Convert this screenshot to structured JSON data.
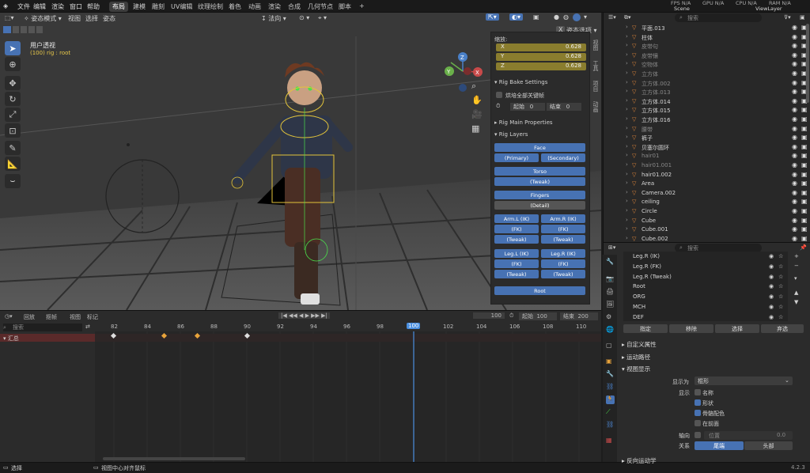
{
  "topbar": {
    "menus": [
      "文件",
      "编辑",
      "渲染",
      "窗口",
      "帮助"
    ],
    "workspaces": [
      "布局",
      "建模",
      "雕刻",
      "UV编辑",
      "纹理绘制",
      "着色",
      "动画",
      "渲染",
      "合成",
      "几何节点",
      "脚本"
    ],
    "active_workspace": "布局",
    "add_tab": "+",
    "scene": "Scene",
    "view_layer": "ViewLayer",
    "fps": "FPS N/A",
    "gpu": "GPU N/A",
    "cpu": "CPU N/A",
    "ram": "RAM N/A"
  },
  "viewport_header": {
    "mode": "姿态模式",
    "menus": [
      "视图",
      "选择",
      "姿态"
    ],
    "orientation": "法向",
    "pose_options": "姿态选项",
    "x_button": "X"
  },
  "viewport": {
    "perspective_label": "用户透视",
    "object_label": "(100) rig : root"
  },
  "npanel": {
    "scale_title": "缩放:",
    "x_label": "X",
    "x_value": "0.628",
    "y_label": "Y",
    "y_value": "0.628",
    "z_label": "Z",
    "z_value": "0.628",
    "bake_title": "Rig Bake Settings",
    "bake_all": "烘培全部关键帧",
    "start_label": "起始",
    "start_value": "0",
    "end_label": "结束",
    "end_value": "0",
    "main_props": "Rig Main Properties",
    "layers_title": "Rig Layers",
    "btn_face": "Face",
    "btn_primary": "(Primary)",
    "btn_secondary": "(Secondary)",
    "btn_torso": "Torso",
    "btn_torso_tweak": "(Tweak)",
    "btn_fingers": "Fingers",
    "btn_detail": "(Detail)",
    "btn_arml_ik": "Arm.L (IK)",
    "btn_armr_ik": "Arm.R (IK)",
    "btn_arml_fk": "(FK)",
    "btn_armr_fk": "(FK)",
    "btn_arml_tweak": "(Tweak)",
    "btn_armr_tweak": "(Tweak)",
    "btn_legl_ik": "Leg.L (IK)",
    "btn_legr_ik": "Leg.R (IK)",
    "btn_legl_fk": "(FK)",
    "btn_legr_fk": "(FK)",
    "btn_legl_tweak": "(Tweak)",
    "btn_legr_tweak": "(Tweak)",
    "btn_root": "Root",
    "side_tabs": [
      "视图",
      "工具",
      "项目",
      "动画"
    ]
  },
  "timeline_header": {
    "menus": [
      "回放",
      "抠帧",
      "视图",
      "标记"
    ],
    "current_frame": "100",
    "start_label": "起始",
    "start_value": "100",
    "end_label": "结束",
    "end_value": "200"
  },
  "timeline": {
    "search_placeholder": "搜索",
    "summary": "汇总",
    "frames": [
      "82",
      "84",
      "86",
      "88",
      "90",
      "92",
      "94",
      "96",
      "98",
      "100",
      "102",
      "104",
      "106",
      "108",
      "110"
    ]
  },
  "statusbar": {
    "select": "选择",
    "center_view": "视图中心对齐鼠标",
    "version": "4.2.3"
  },
  "outliner": {
    "search_placeholder": "搜索",
    "rows": [
      {
        "name": "平面.013",
        "dim": false
      },
      {
        "name": "柱体",
        "dim": false
      },
      {
        "name": "皮带句",
        "dim": true
      },
      {
        "name": "皮带镶",
        "dim": true
      },
      {
        "name": "空物体",
        "dim": true
      },
      {
        "name": "立方体",
        "dim": true
      },
      {
        "name": "立方体.002",
        "dim": true
      },
      {
        "name": "立方体.013",
        "dim": true
      },
      {
        "name": "立方体.014",
        "dim": false
      },
      {
        "name": "立方体.015",
        "dim": false
      },
      {
        "name": "立方体.016",
        "dim": false
      },
      {
        "name": "腰带",
        "dim": true
      },
      {
        "name": "裤子",
        "dim": false
      },
      {
        "name": "贝塞尔圆环",
        "dim": false
      },
      {
        "name": "hair01",
        "dim": true
      },
      {
        "name": "hair01.001",
        "dim": true
      },
      {
        "name": "hair01.002",
        "dim": false
      },
      {
        "name": "Area",
        "dim": false
      },
      {
        "name": "Camera.002",
        "dim": false
      },
      {
        "name": "ceiling",
        "dim": false
      },
      {
        "name": "Circle",
        "dim": false
      },
      {
        "name": "Cube",
        "dim": false
      },
      {
        "name": "Cube.001",
        "dim": false
      },
      {
        "name": "Cube.002",
        "dim": false
      }
    ]
  },
  "properties": {
    "search_placeholder": "搜索",
    "collections": [
      "Leg.R (IK)",
      "Leg.R (FK)",
      "Leg.R (Tweak)",
      "Root",
      "ORG",
      "MCH",
      "DEF"
    ],
    "btn_assign": "指定",
    "btn_remove": "移除",
    "btn_select": "选择",
    "btn_deselect": "弃选",
    "custom_props": "自定义属性",
    "motion_paths": "运动路径",
    "viewport_display": "视图显示",
    "display_as_label": "显示为",
    "display_as_value": "棍形",
    "show_label": "显示",
    "show_names": "名称",
    "show_shapes": "形状",
    "bone_colors": "骨骼配色",
    "in_front": "在前面",
    "axes_label": "轴向",
    "axes_position": "位置",
    "axes_value": "0.0",
    "relation_label": "关系",
    "rel_tail": "尾端",
    "rel_head": "头部",
    "inverse_kinematics": "反向运动学"
  },
  "colors": {
    "accent": "#4772b3",
    "scale_field": "#8a7d2e",
    "keyframe_orange": "#e8a33b",
    "keyframe_white": "#dddddd",
    "playhead": "#4a8fe0"
  }
}
